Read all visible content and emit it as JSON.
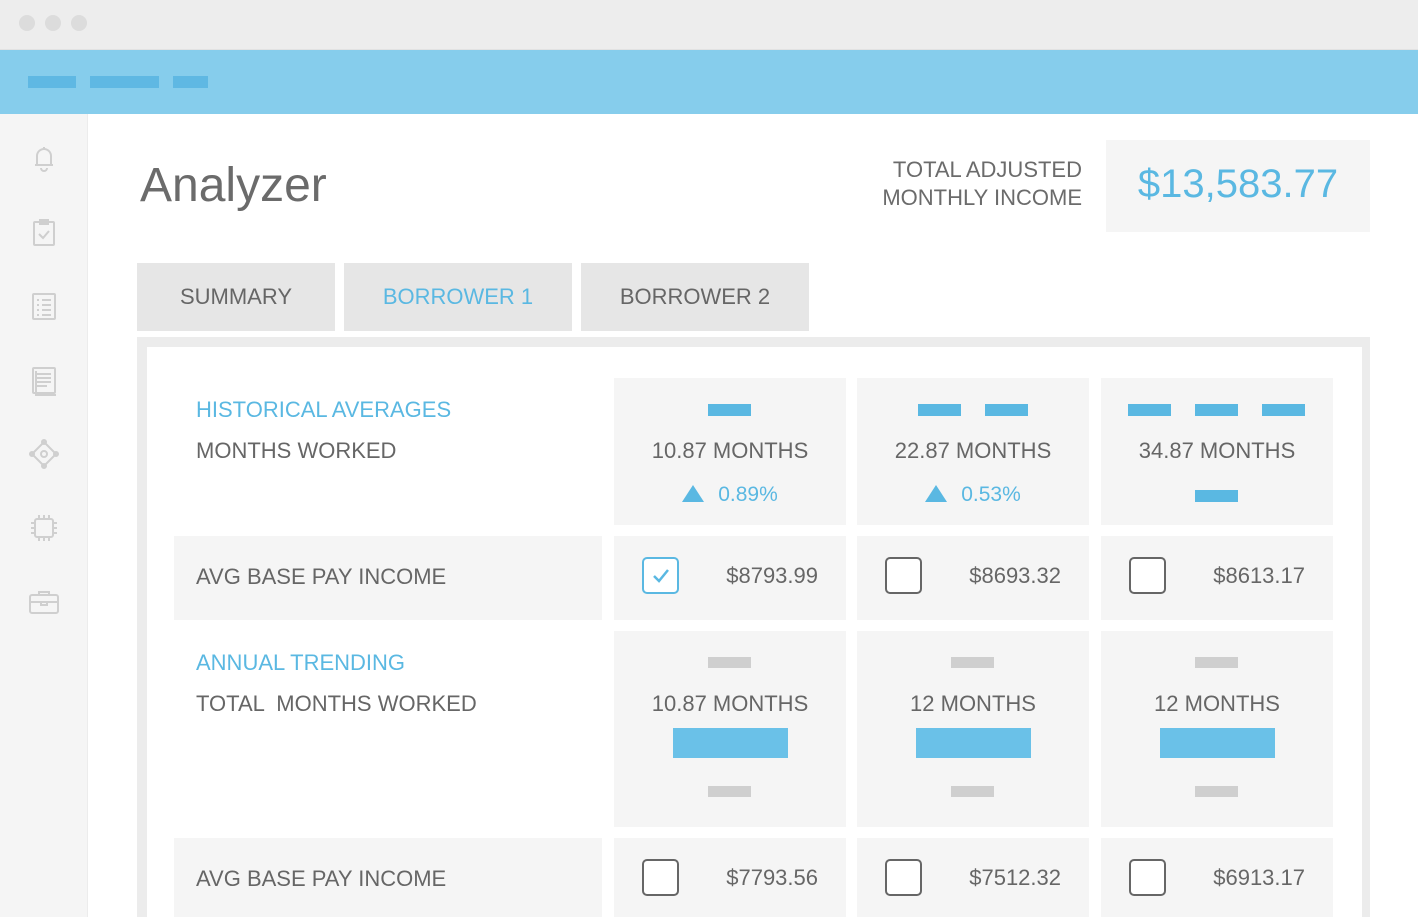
{
  "colors": {
    "accent": "#5ab8e2",
    "topbar": "#86cdec",
    "panel": "#f5f5f5"
  },
  "sidebar": {
    "icons": [
      "bell-icon",
      "clipboard-check-icon",
      "list-icon",
      "document-icon",
      "network-icon",
      "chip-icon",
      "briefcase-icon"
    ]
  },
  "header": {
    "title": "Analyzer",
    "total_label_line1": "TOTAL ADJUSTED",
    "total_label_line2": "MONTHLY INCOME",
    "total_value": "$13,583.77"
  },
  "tabs": [
    {
      "label": "SUMMARY",
      "active": false
    },
    {
      "label": "BORROWER 1",
      "active": true
    },
    {
      "label": "BORROWER 2",
      "active": false
    }
  ],
  "historical": {
    "title": "HISTORICAL AVERAGES",
    "subtitle": "MONTHS WORKED",
    "columns": [
      {
        "months": "10.87 MONTHS",
        "change": "0.89%",
        "trend": "up"
      },
      {
        "months": "22.87 MONTHS",
        "change": "0.53%",
        "trend": "up"
      },
      {
        "months": "34.87 MONTHS",
        "change": "",
        "trend": "flat"
      }
    ],
    "income_label": "AVG BASE PAY INCOME",
    "incomes": [
      {
        "value": "$8793.99",
        "checked": true
      },
      {
        "value": "$8693.32",
        "checked": false
      },
      {
        "value": "$8613.17",
        "checked": false
      }
    ]
  },
  "annual": {
    "title": "ANNUAL TRENDING",
    "subtitle": "TOTAL  MONTHS WORKED",
    "columns": [
      {
        "months": "10.87 MONTHS"
      },
      {
        "months": "12 MONTHS"
      },
      {
        "months": "12 MONTHS"
      }
    ],
    "income_label": "AVG BASE PAY INCOME",
    "incomes": [
      {
        "value": "$7793.56",
        "checked": false
      },
      {
        "value": "$7512.32",
        "checked": false
      },
      {
        "value": "$6913.17",
        "checked": false
      }
    ]
  }
}
